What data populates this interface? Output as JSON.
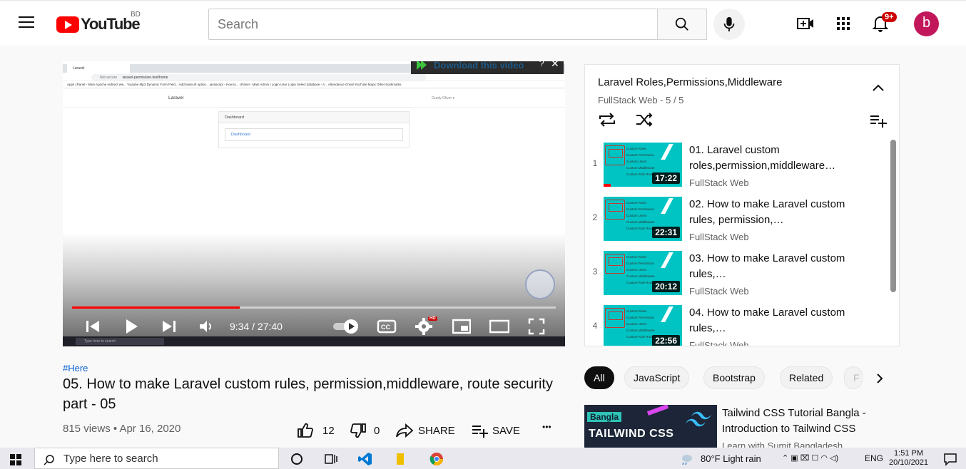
{
  "header": {
    "logo_text": "YouTube",
    "country_code": "BD",
    "search_placeholder": "Search",
    "notification_count": "9+",
    "avatar_letter": "b"
  },
  "player": {
    "browser_tab": "Laravel",
    "url_prefix": "Not secure",
    "url": "laravel-permission.test/home",
    "bookmarks": "Apps   cPanel - Main   Apache redirect ww...   Youtube Mp3   Dynamic Form Field...   Add baseUrl option...   javascript - How to...   cPanel - Main   Admin | Login   User Login   Select database - A...   Attendance   Gmail   YouTube   Maps      Other bookmarks",
    "app_brand": "Laravel",
    "app_user": "Grady Oliver ▾",
    "card_header": "Dashboard",
    "card_body": "Dashboard",
    "download_text": "Download this video",
    "download_help": "?",
    "time_display": "9:34 / 27:40",
    "progress": 0.346,
    "quality_badge": "HD",
    "taskbar_search": "Type here to search"
  },
  "video": {
    "hashtag": "#Here",
    "title": "05. How to make Laravel custom rules, permission,middleware, route security part - 05",
    "views_date": "815 views • Apr 16, 2020",
    "likes": "12",
    "dislikes": "0",
    "share_label": "SHARE",
    "save_label": "SAVE",
    "more_label": "•••"
  },
  "playlist": {
    "title": "Laravel Roles,Permissions,Middleware",
    "subtitle": "FullStack Web - 5 / 5",
    "items": [
      {
        "index": "1",
        "title": "01. Laravel custom roles,permission,middleware…",
        "channel": "FullStack Web",
        "duration": "17:22",
        "watched": 0.09
      },
      {
        "index": "2",
        "title": "02. How to make Laravel custom rules, permission,…",
        "channel": "FullStack Web",
        "duration": "22:31",
        "watched": 0
      },
      {
        "index": "3",
        "title": "03. How to make Laravel custom rules,…",
        "channel": "FullStack Web",
        "duration": "20:12",
        "watched": 0
      },
      {
        "index": "4",
        "title": "04. How to make Laravel custom rules,…",
        "channel": "FullStack Web",
        "duration": "22:56",
        "watched": 0
      }
    ],
    "thumb_lines": [
      "Custom Roles",
      "Custom Permission",
      "Custom Users",
      "Custom Middleware",
      "Custom Role Route"
    ]
  },
  "chips": [
    "All",
    "JavaScript",
    "Bootstrap",
    "Related",
    "F"
  ],
  "related": {
    "thumb_tag": "Bangla",
    "thumb_title": "TAILWIND CSS",
    "title": "Tailwind CSS Tutorial Bangla - Introduction to Tailwind CSS",
    "channel": "Learn with Sumit Bangladesh"
  },
  "taskbar": {
    "search_text": "Type here to search",
    "weather": "80°F  Light rain",
    "language": "ENG",
    "time": "1:51 PM",
    "date": "20/10/2021"
  },
  "colors": {
    "brand_red": "#ff0000",
    "link_blue": "#065fd4",
    "thumb_cyan": "#00c4c4"
  }
}
